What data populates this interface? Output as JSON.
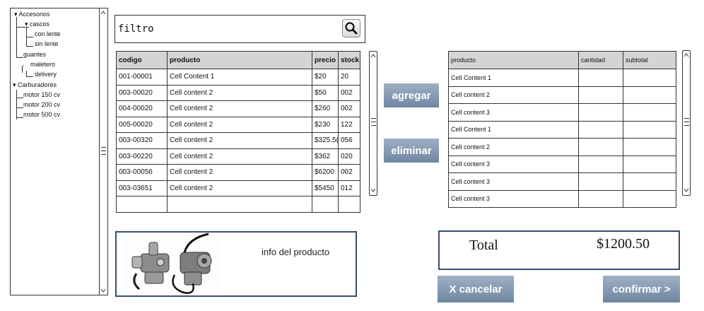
{
  "tree": {
    "items": [
      {
        "label": "Accesorios",
        "expanded": true
      },
      {
        "label": "cascos",
        "expanded": true
      },
      {
        "label": "con lente"
      },
      {
        "label": "sin lente"
      },
      {
        "label": "guantes"
      },
      {
        "label": "maletero"
      },
      {
        "label": "delivery"
      },
      {
        "label": "Carburadores",
        "expanded": true
      },
      {
        "label": "motor 150 cv"
      },
      {
        "label": "motor 200 cv"
      },
      {
        "label": "motor 500 cv"
      }
    ]
  },
  "filter": {
    "value": "filtro",
    "icon": "search-icon"
  },
  "products_table": {
    "columns": [
      "codigo",
      "producto",
      "precio",
      "stock"
    ],
    "rows": [
      [
        "001-00001",
        "Cell Content 1",
        "$20",
        "20"
      ],
      [
        "003-00020",
        "Cell content 2",
        "$50",
        "002"
      ],
      [
        "004-00020",
        "Cell content 2",
        "$260",
        "002"
      ],
      [
        "005-00020",
        "Cell content 2",
        "$230",
        "122"
      ],
      [
        "003-00320",
        "Cell content 2",
        "$325.5(",
        "056"
      ],
      [
        "003-00220",
        "Cell content 2",
        "$362",
        "020"
      ],
      [
        "003-00056",
        "Cell content 2",
        "$6200",
        "002"
      ],
      [
        "003-03651",
        "Cell content 2",
        "$5450",
        "012"
      ],
      [
        "",
        "",
        "",
        ""
      ]
    ]
  },
  "actions": {
    "add_label": "agregar",
    "remove_label": "eliminar"
  },
  "cart_table": {
    "columns": [
      "producto",
      "cantidad",
      "subtotal"
    ],
    "rows": [
      [
        "Cell Content 1",
        "",
        ""
      ],
      [
        "Cell content 2",
        "",
        ""
      ],
      [
        "Cell content 3",
        "",
        ""
      ],
      [
        "Cell Content 1",
        "",
        ""
      ],
      [
        "Cell content 2",
        "",
        ""
      ],
      [
        "Cell content 3",
        "",
        ""
      ],
      [
        "Cell content 3",
        "",
        ""
      ],
      [
        "Cell content 3",
        "",
        ""
      ]
    ]
  },
  "product_info": {
    "label": "info del producto",
    "image": "carburetor-image"
  },
  "total": {
    "label": "Total",
    "value": "$1200.50"
  },
  "footer": {
    "cancel_label": "X cancelar",
    "confirm_label": "confirmar >"
  },
  "colors": {
    "button": "#7f93ad",
    "border": "#3a4d6b",
    "header": "#d4d4d4"
  }
}
